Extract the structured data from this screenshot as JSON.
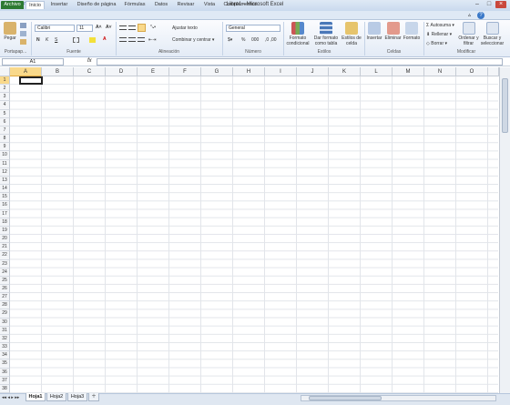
{
  "window": {
    "title": "Libro1 - Microsoft Excel"
  },
  "tabs": [
    {
      "label": "Archivo"
    },
    {
      "label": "Inicio"
    },
    {
      "label": "Insertar"
    },
    {
      "label": "Diseño de página"
    },
    {
      "label": "Fórmulas"
    },
    {
      "label": "Datos"
    },
    {
      "label": "Revisar"
    },
    {
      "label": "Vista"
    },
    {
      "label": "Complementos"
    }
  ],
  "ribbon": {
    "clipboard": {
      "paste": "Pegar",
      "group": "Portapap..."
    },
    "font": {
      "name": "Calibri",
      "size": "11",
      "group": "Fuente"
    },
    "alignment": {
      "wrap": "Ajustar texto",
      "merge": "Combinar y centrar",
      "group": "Alineación"
    },
    "number": {
      "format": "General",
      "group": "Número"
    },
    "styles": {
      "conditional": "Formato condicional",
      "table": "Dar formato como tabla",
      "cell_styles": "Estilos de celda",
      "group": "Estilos"
    },
    "cells": {
      "insert": "Insertar",
      "delete": "Eliminar",
      "format": "Formato",
      "group": "Celdas"
    },
    "editing": {
      "autosum": "Autosuma",
      "fill": "Rellenar",
      "clear": "Borrar",
      "sort": "Ordenar y filtrar",
      "find": "Buscar y seleccionar",
      "group": "Modificar"
    }
  },
  "formula_bar": {
    "cell": "A1",
    "fx": "fx"
  },
  "columns": [
    "A",
    "B",
    "C",
    "D",
    "E",
    "F",
    "G",
    "H",
    "I",
    "J",
    "K",
    "L",
    "M",
    "N",
    "O"
  ],
  "rows": [
    "1",
    "2",
    "3",
    "4",
    "5",
    "6",
    "7",
    "8",
    "9",
    "10",
    "11",
    "12",
    "13",
    "14",
    "15",
    "16",
    "17",
    "18",
    "19",
    "20",
    "21",
    "22",
    "23",
    "24",
    "25",
    "26",
    "27",
    "28",
    "29",
    "30",
    "31",
    "32",
    "33",
    "34",
    "35",
    "36",
    "37",
    "38"
  ],
  "sheets": [
    "Hoja1",
    "Hoja2",
    "Hoja3"
  ],
  "colors": {
    "file_tab": "#2d7a32",
    "selected_header": "#f9d98b"
  }
}
